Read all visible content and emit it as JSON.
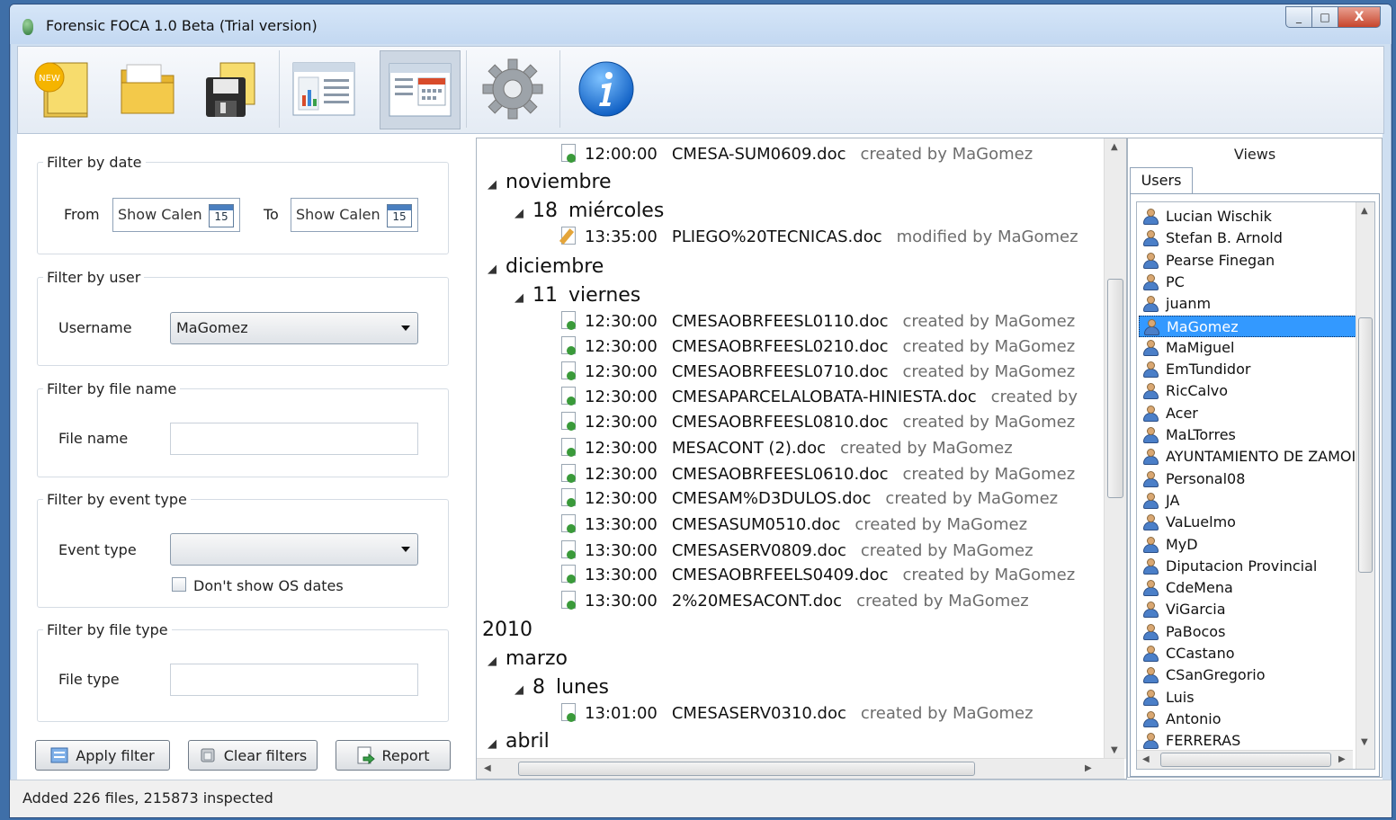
{
  "window": {
    "title": "Forensic FOCA 1.0 Beta (Trial version)",
    "minimize_label": "_",
    "maximize_label": "□",
    "close_label": "X"
  },
  "toolbar": {
    "new_badge": "NEW"
  },
  "filters": {
    "date": {
      "legend": "Filter by date",
      "from_label": "From",
      "from_value": "Show Calen",
      "to_label": "To",
      "to_value": "Show Calen",
      "cal_day": "15"
    },
    "user": {
      "legend": "Filter by user",
      "username_label": "Username",
      "username_value": "MaGomez"
    },
    "file_name": {
      "legend": "Filter by file name",
      "label": "File name",
      "value": ""
    },
    "event_type": {
      "legend": "Filter by event type",
      "label": "Event type",
      "value": "",
      "os_dates_label": "Don't show OS dates"
    },
    "file_type": {
      "legend": "Filter by file type",
      "label": "File type",
      "value": ""
    },
    "buttons": {
      "apply": "Apply filter",
      "clear": "Clear filters",
      "report": "Report"
    }
  },
  "timeline": {
    "rows": [
      {
        "kind": "file",
        "icon": "created",
        "time": "12:00:00",
        "file": "CMESA-SUM0609.doc",
        "action": "created by MaGomez"
      },
      {
        "kind": "month",
        "label": "noviembre"
      },
      {
        "kind": "day",
        "num": "18",
        "label": "miércoles"
      },
      {
        "kind": "file",
        "icon": "modified",
        "time": "13:35:00",
        "file": "PLIEGO%20TECNICAS.doc",
        "action": "modified by MaGomez"
      },
      {
        "kind": "month",
        "label": "diciembre"
      },
      {
        "kind": "day",
        "num": "11",
        "label": "viernes"
      },
      {
        "kind": "file",
        "icon": "created",
        "time": "12:30:00",
        "file": "CMESAOBRFEESL0110.doc",
        "action": "created by MaGomez"
      },
      {
        "kind": "file",
        "icon": "created",
        "time": "12:30:00",
        "file": "CMESAOBRFEESL0210.doc",
        "action": "created by MaGomez"
      },
      {
        "kind": "file",
        "icon": "created",
        "time": "12:30:00",
        "file": "CMESAOBRFEESL0710.doc",
        "action": "created by MaGomez"
      },
      {
        "kind": "file",
        "icon": "created",
        "time": "12:30:00",
        "file": "CMESAPARCELALOBATA-HINIESTA.doc",
        "action": "created by"
      },
      {
        "kind": "file",
        "icon": "created",
        "time": "12:30:00",
        "file": "CMESAOBRFEESL0810.doc",
        "action": "created by MaGomez"
      },
      {
        "kind": "file",
        "icon": "created",
        "time": "12:30:00",
        "file": "MESACONT (2).doc",
        "action": "created by MaGomez"
      },
      {
        "kind": "file",
        "icon": "created",
        "time": "12:30:00",
        "file": "CMESAOBRFEESL0610.doc",
        "action": "created by MaGomez"
      },
      {
        "kind": "file",
        "icon": "created",
        "time": "12:30:00",
        "file": "CMESAM%D3DULOS.doc",
        "action": "created by MaGomez"
      },
      {
        "kind": "file",
        "icon": "created",
        "time": "13:30:00",
        "file": "CMESASUM0510.doc",
        "action": "created by MaGomez"
      },
      {
        "kind": "file",
        "icon": "created",
        "time": "13:30:00",
        "file": "CMESASERV0809.doc",
        "action": "created by MaGomez"
      },
      {
        "kind": "file",
        "icon": "created",
        "time": "13:30:00",
        "file": "CMESAOBRFEELS0409.doc",
        "action": "created by MaGomez"
      },
      {
        "kind": "file",
        "icon": "created",
        "time": "13:30:00",
        "file": "2%20MESACONT.doc",
        "action": "created by MaGomez"
      },
      {
        "kind": "year",
        "label": "2010"
      },
      {
        "kind": "month",
        "label": "marzo"
      },
      {
        "kind": "day",
        "num": "8",
        "label": "lunes"
      },
      {
        "kind": "file",
        "icon": "created",
        "time": "13:01:00",
        "file": "CMESASERV0310.doc",
        "action": "created by MaGomez"
      },
      {
        "kind": "month",
        "label": "abril"
      }
    ]
  },
  "views": {
    "title": "Views",
    "tab": "Users",
    "selected": "MaGomez",
    "users": [
      "Lucian Wischik",
      "Stefan B. Arnold",
      "Pearse Finegan",
      "PC",
      "juanm",
      "MaGomez",
      "MaMiguel",
      "EmTundidor",
      "RicCalvo",
      "Acer",
      "MaLTorres",
      "AYUNTAMIENTO DE ZAMOI",
      "Personal08",
      "JA",
      "VaLuelmo",
      "MyD",
      "Diputacion Provincial",
      "CdeMena",
      "ViGarcia",
      "PaBocos",
      "CCastano",
      "CSanGregorio",
      "Luis",
      "Antonio",
      "FERRERAS"
    ]
  },
  "status": {
    "text": "Added 226 files, 215873 inspected"
  },
  "colors": {
    "selection": "#3399ff",
    "created_icon": "#3a9a3a",
    "modified_icon": "#e4a53a"
  }
}
